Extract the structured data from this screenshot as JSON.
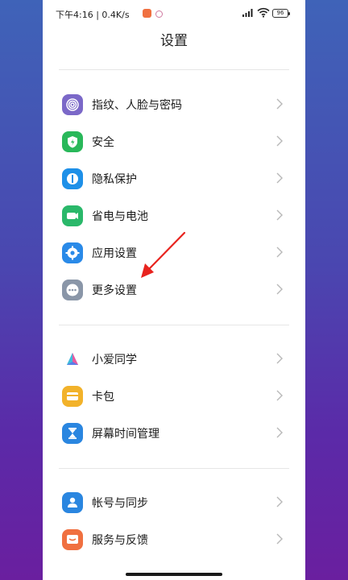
{
  "status_bar": {
    "time_speed": "下午4:16 | 0.4K/s",
    "battery": "96"
  },
  "title": "设置",
  "groups": [
    {
      "items": [
        {
          "label": "指纹、人脸与密码",
          "icon": "fingerprint-icon",
          "color": "#7b68c8"
        },
        {
          "label": "安全",
          "icon": "shield-icon",
          "color": "#29b85a"
        },
        {
          "label": "隐私保护",
          "icon": "privacy-icon",
          "color": "#1e90e8"
        },
        {
          "label": "省电与电池",
          "icon": "battery-icon",
          "color": "#2ab86a"
        },
        {
          "label": "应用设置",
          "icon": "gear-icon",
          "color": "#2a8ae8"
        },
        {
          "label": "更多设置",
          "icon": "more-icon",
          "color": "#8a96a8"
        }
      ]
    },
    {
      "items": [
        {
          "label": "小爱同学",
          "icon": "xiaoai-icon",
          "color": "#5a7de8"
        },
        {
          "label": "卡包",
          "icon": "wallet-icon",
          "color": "#f2b22a"
        },
        {
          "label": "屏幕时间管理",
          "icon": "hourglass-icon",
          "color": "#2a86e0"
        }
      ]
    },
    {
      "items": [
        {
          "label": "帐号与同步",
          "icon": "account-icon",
          "color": "#2a86e0"
        },
        {
          "label": "服务与反馈",
          "icon": "feedback-icon",
          "color": "#f07040"
        }
      ]
    }
  ],
  "annotation_color": "#e8231e"
}
